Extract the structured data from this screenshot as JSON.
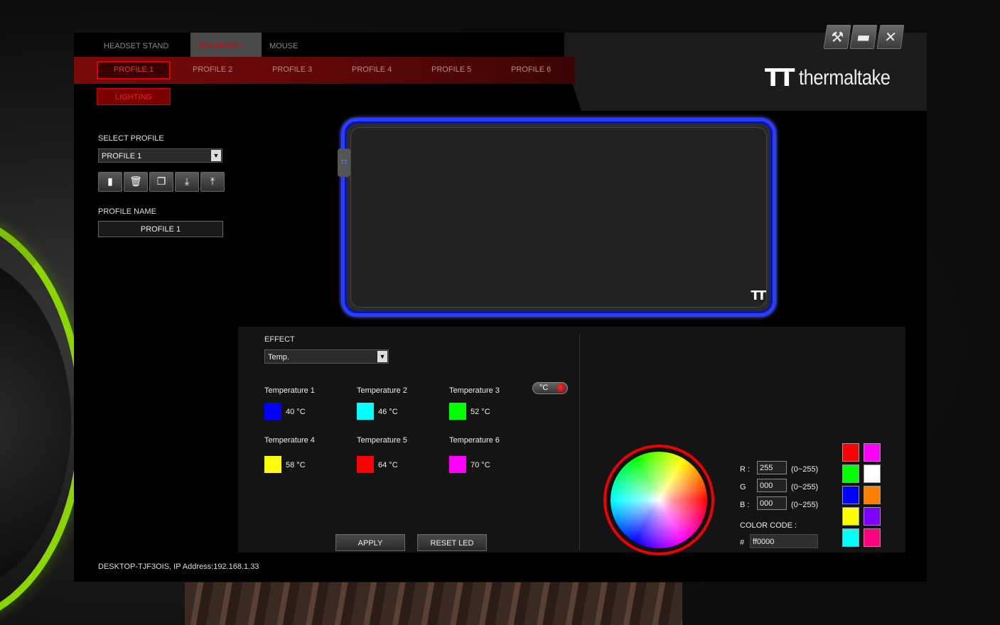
{
  "device_tabs": [
    "HEADSET STAND",
    "MOUSEPAD",
    "MOUSE"
  ],
  "active_device": "MOUSEPAD",
  "profile_tabs": [
    "PROFILE 1",
    "PROFILE 2",
    "PROFILE 3",
    "PROFILE 4",
    "PROFILE 5",
    "PROFILE 6"
  ],
  "active_profile": "PROFILE 1",
  "lighting_label": "LIGHTING",
  "brand": {
    "mark": "TT",
    "word": "thermaltake"
  },
  "window_buttons": {
    "settings": "settings-icon",
    "minimize": "minimize-icon",
    "close": "close-icon"
  },
  "select_profile": {
    "label": "SELECT PROFILE",
    "value": "PROFILE 1"
  },
  "profile_actions": [
    "save-icon",
    "delete-icon",
    "copy-icon",
    "import-icon",
    "export-icon"
  ],
  "profile_name": {
    "label": "PROFILE NAME",
    "value": "PROFILE 1"
  },
  "effect": {
    "label": "EFFECT",
    "value": "Temp."
  },
  "temperatures": [
    {
      "label": "Temperature 1",
      "value": "40 °C",
      "color": "#0000ff"
    },
    {
      "label": "Temperature 2",
      "value": "46 °C",
      "color": "#00ffff"
    },
    {
      "label": "Temperature 3",
      "value": "52 °C",
      "color": "#00ff00"
    },
    {
      "label": "Temperature 4",
      "value": "58 °C",
      "color": "#ffff00"
    },
    {
      "label": "Temperature 5",
      "value": "64 °C",
      "color": "#ff0000"
    },
    {
      "label": "Temperature 6",
      "value": "70 °C",
      "color": "#ff00ff"
    }
  ],
  "unit_toggle": "°C",
  "buttons": {
    "apply": "APPLY",
    "reset": "RESET LED"
  },
  "rgb": {
    "r_label": "R :",
    "r": "255",
    "g_label": "G",
    "g": "000",
    "b_label": "B :",
    "b": "000",
    "range": "(0~255)"
  },
  "color_code": {
    "label": "COLOR CODE :",
    "hash": "#",
    "value": "ff0000"
  },
  "preset_colors": [
    "#ff0000",
    "#ff00ff",
    "#00ff00",
    "#ffffff",
    "#0000ff",
    "#ff8000",
    "#ffff00",
    "#8000ff",
    "#00ffff",
    "#ff0080"
  ],
  "status": "DESKTOP-TJF3OIS, IP Address:192.168.1.33",
  "accent_color": "#e00000",
  "pad_glow_color": "#2a3cff"
}
